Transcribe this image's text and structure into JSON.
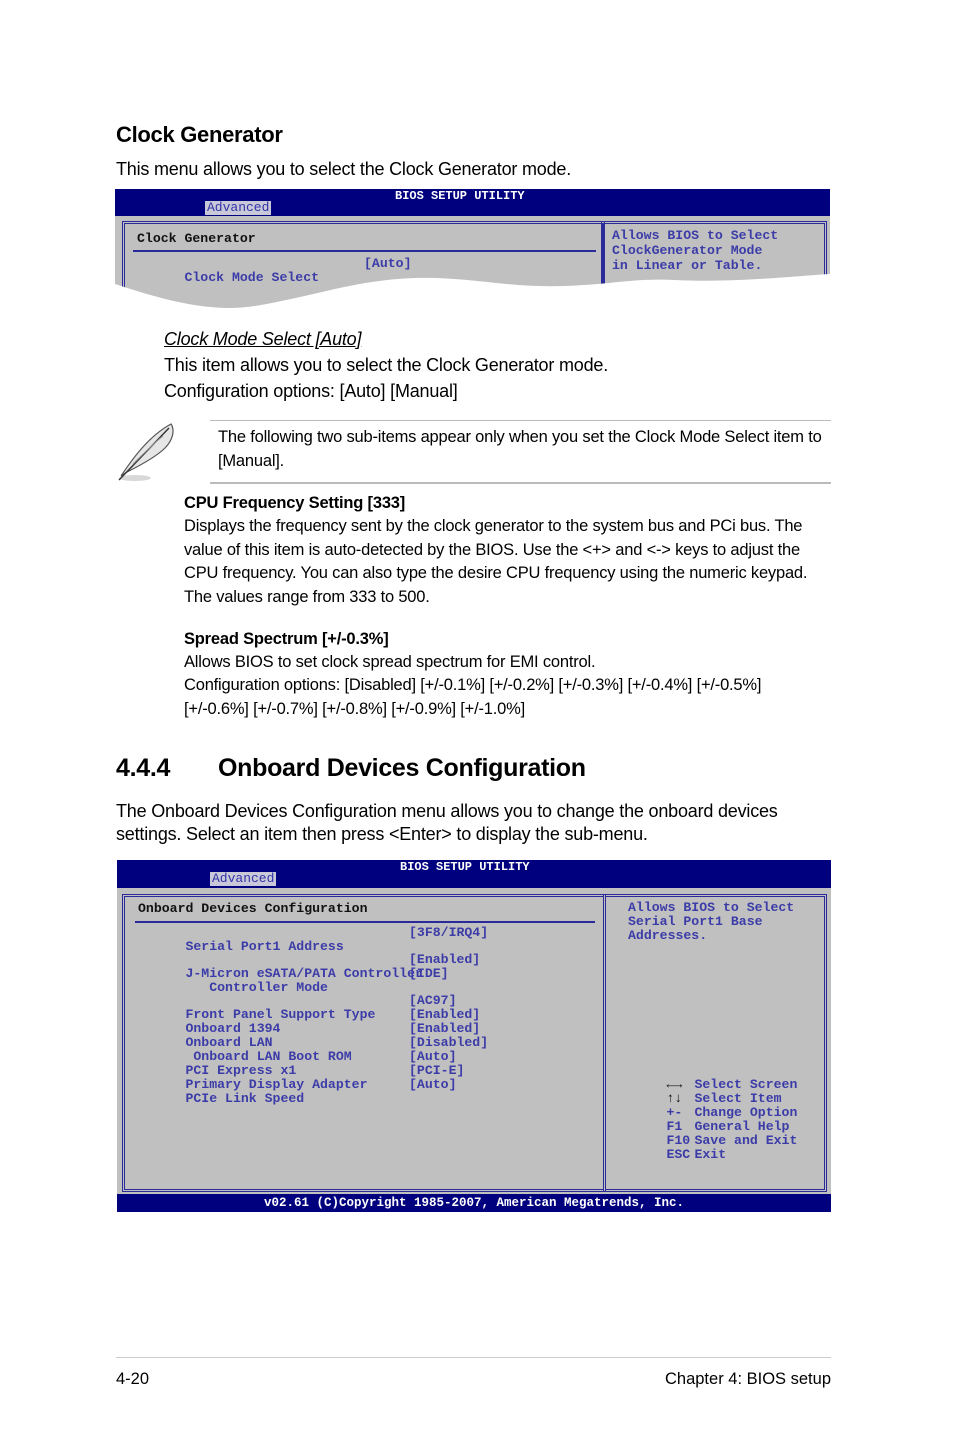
{
  "clock_generator": {
    "heading": "Clock Generator",
    "intro": "This menu allows you to select the Clock Generator mode."
  },
  "bios1": {
    "title": "BIOS SETUP UTILITY",
    "tab": "Advanced",
    "section": "Clock Generator",
    "items": [
      {
        "label": "Clock Mode Select",
        "value": "[Auto]"
      }
    ],
    "help": [
      "Allows BIOS to Select",
      "ClockGenerator Mode",
      "in Linear or Table."
    ]
  },
  "clock_mode": {
    "title": "Clock Mode Select [Auto]",
    "line1": "This item allows you to select the Clock Generator mode.",
    "line2": "Configuration options: [Auto] [Manual]"
  },
  "note": {
    "icon": "feather-pen-icon",
    "text": "The following two sub-items appear only when you set the Clock Mode Select item to [Manual]."
  },
  "cpu_freq": {
    "title": "CPU Frequency Setting [333]",
    "body": "Displays the frequency sent by the clock generator to the system bus and PCi bus. The value of this item is auto-detected by the BIOS. Use the <+> and <-> keys to adjust the CPU frequency. You can also type the desire CPU frequency using the numeric keypad. The values range from 333 to 500."
  },
  "spread_spectrum": {
    "title": "Spread Spectrum [+/-0.3%]",
    "line1": "Allows BIOS to set clock spread spectrum for EMI control.",
    "line2": "Configuration options: [Disabled] [+/-0.1%] [+/-0.2%] [+/-0.3%] [+/-0.4%] [+/-0.5%] [+/-0.6%] [+/-0.7%] [+/-0.8%] [+/-0.9%] [+/-1.0%]"
  },
  "onboard": {
    "number": "4.4.4",
    "heading": "Onboard Devices Configuration",
    "intro": "The Onboard Devices Configuration menu allows you to change the onboard devices settings. Select an item then press <Enter> to display the sub-menu."
  },
  "bios2": {
    "title": "BIOS SETUP UTILITY",
    "tab": "Advanced",
    "section": "Onboard Devices Configuration",
    "items": [
      {
        "label": "Serial Port1 Address",
        "value": "[3F8/IRQ4]"
      },
      {
        "label": "J-Micron eSATA/PATA Controller",
        "value": "[Enabled]"
      },
      {
        "label": "   Controller Mode",
        "value": "[IDE]"
      },
      {
        "label": "Front Panel Support Type",
        "value": "[AC97]"
      },
      {
        "label": "Onboard 1394",
        "value": "[Enabled]"
      },
      {
        "label": "Onboard LAN",
        "value": "[Enabled]"
      },
      {
        "label": " Onboard LAN Boot ROM",
        "value": "[Disabled]"
      },
      {
        "label": "PCI Express x1",
        "value": "[Auto]"
      },
      {
        "label": "Primary Display Adapter",
        "value": "[PCI-E]"
      },
      {
        "label": "PCIe Link Speed",
        "value": "[Auto]"
      }
    ],
    "help": [
      "Allows BIOS to Select",
      "Serial Port1 Base",
      "Addresses."
    ],
    "keys": [
      {
        "key": "←→",
        "icon": "left-right-arrows-icon",
        "action": "Select Screen"
      },
      {
        "key": "↑↓",
        "icon": "up-down-arrows-icon",
        "action": "Select Item"
      },
      {
        "key": "+-",
        "action": "Change Option"
      },
      {
        "key": "F1",
        "action": "General Help"
      },
      {
        "key": "F10",
        "action": "Save and Exit"
      },
      {
        "key": "ESC",
        "action": "Exit"
      }
    ],
    "footer": "v02.61 (C)Copyright 1985-2007, American Megatrends, Inc."
  },
  "page_footer": {
    "page_number": "4-20",
    "chapter": "Chapter 4: BIOS setup"
  }
}
